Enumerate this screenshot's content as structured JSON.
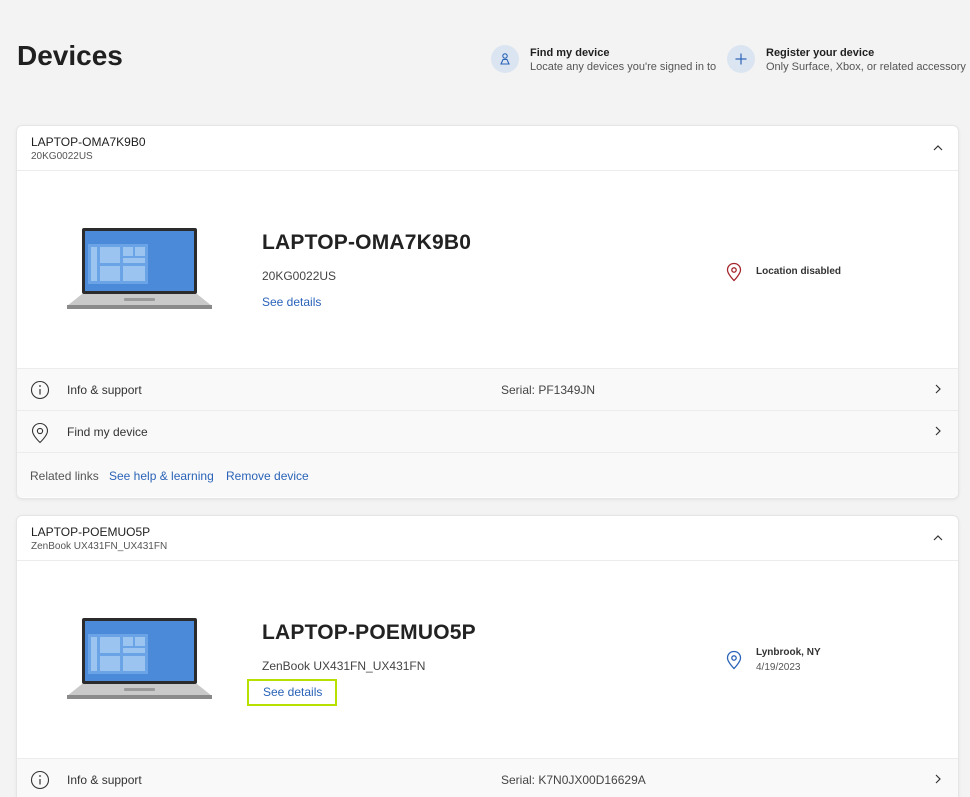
{
  "page": {
    "title": "Devices"
  },
  "header_actions": {
    "find": {
      "title": "Find my device",
      "subtitle": "Locate any devices you're signed in to",
      "icon": "person-pin-icon"
    },
    "register": {
      "title": "Register your device",
      "subtitle": "Only Surface, Xbox, or related accessory",
      "icon": "plus-icon"
    }
  },
  "devices": [
    {
      "header_name": "LAPTOP-OMA7K9B0",
      "header_model": "20KG0022US",
      "name": "LAPTOP-OMA7K9B0",
      "model": "20KG0022US",
      "see_details": "See details",
      "location": {
        "status": "Location disabled",
        "date": "",
        "color": "#a4262c"
      },
      "info_label": "Info & support",
      "serial": "Serial: PF1349JN",
      "find_label": "Find my device",
      "related": {
        "label": "Related links",
        "help": "See help & learning",
        "remove": "Remove device"
      }
    },
    {
      "header_name": "LAPTOP-POEMUO5P",
      "header_model": "ZenBook UX431FN_UX431FN",
      "name": "LAPTOP-POEMUO5P",
      "model": "ZenBook UX431FN_UX431FN",
      "see_details": "See details",
      "location": {
        "status": "Lynbrook, NY",
        "date": "4/19/2023",
        "color": "#2a63b8"
      },
      "info_label": "Info & support",
      "serial": "Serial: K7N0JX00D16629A"
    }
  ],
  "colors": {
    "link": "#2a63b8",
    "highlight": "#b7e000",
    "background": "#f3f3f3"
  }
}
